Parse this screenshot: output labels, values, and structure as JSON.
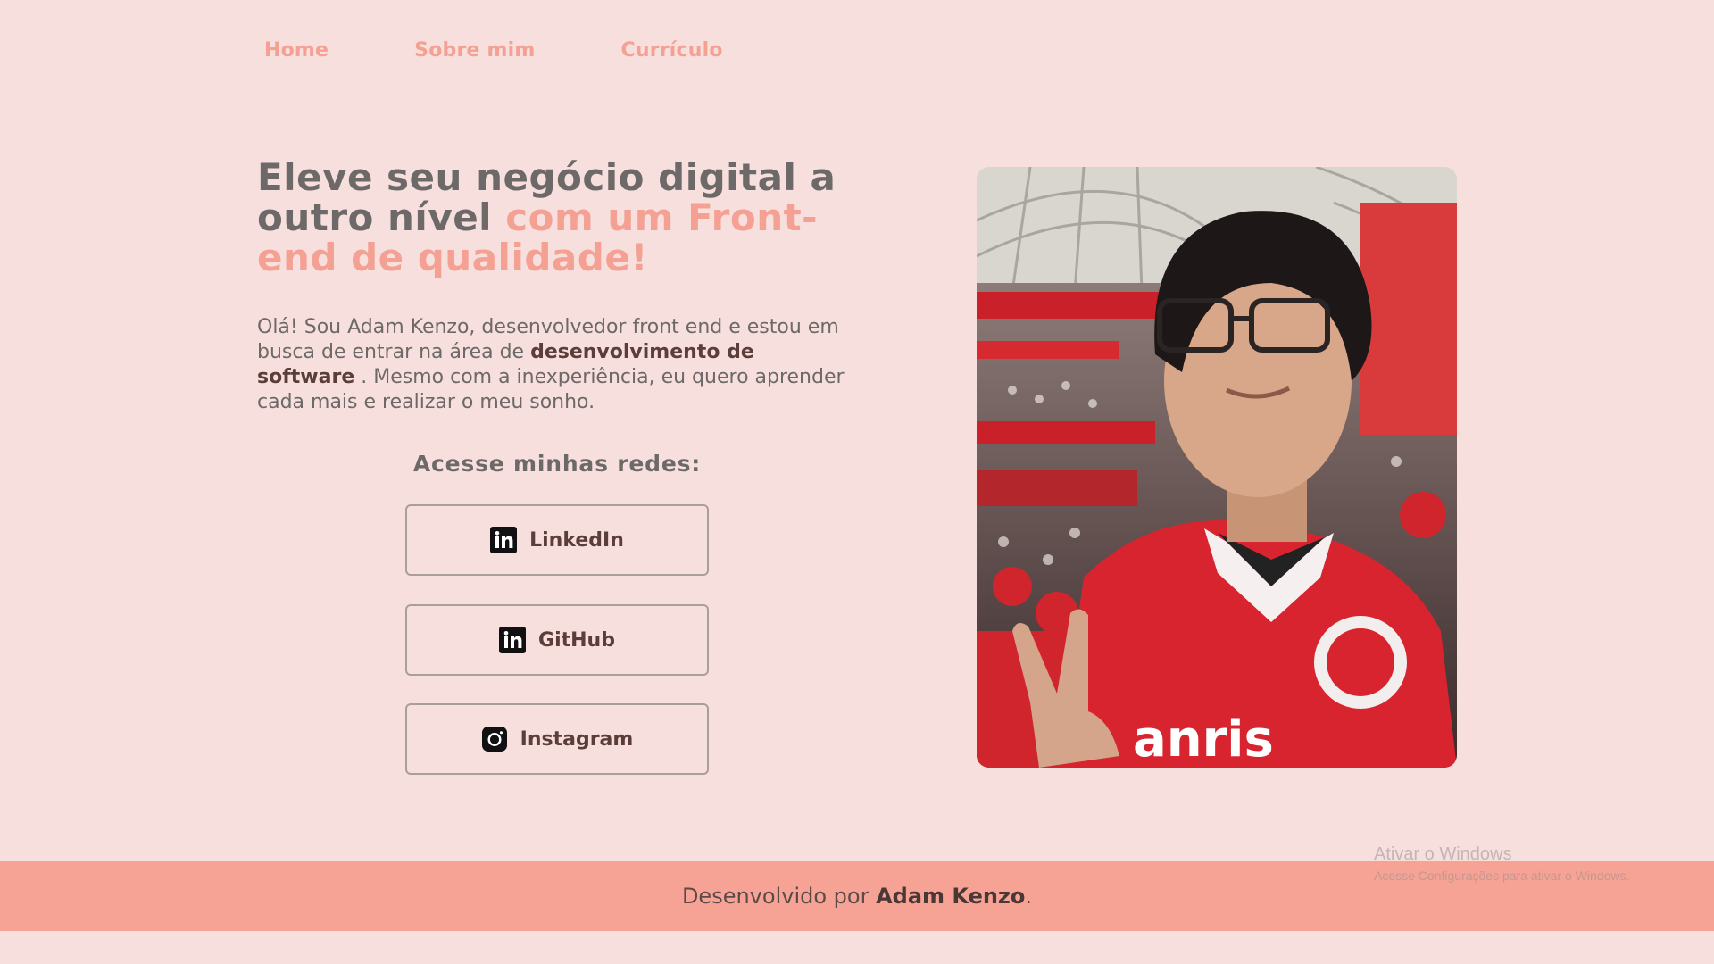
{
  "nav": {
    "items": [
      {
        "label": "Home"
      },
      {
        "label": "Sobre mim"
      },
      {
        "label": "Currículo"
      }
    ]
  },
  "hero": {
    "title_plain": "Eleve seu negócio digital a outro nível",
    "title_accent": "com um Front-end de qualidade!",
    "intro_pre": "Olá! Sou Adam Kenzo, desenvolvedor front end e estou em busca de entrar na área de",
    "intro_bold": "desenvolvimento de software",
    "intro_post": ". Mesmo com a inexperiência, eu quero aprender cada mais e realizar o meu sonho."
  },
  "socials": {
    "title": "Acesse minhas redes:",
    "buttons": [
      {
        "label": "LinkedIn",
        "icon": "linkedin-icon"
      },
      {
        "label": "GitHub",
        "icon": "linkedin-icon"
      },
      {
        "label": "Instagram",
        "icon": "instagram-icon"
      }
    ]
  },
  "footer": {
    "prefix": "Desenvolvido por",
    "name": "Adam Kenzo",
    "suffix": "."
  },
  "watermark": {
    "title": "Ativar o Windows",
    "subtitle": "Acesse Configurações para ativar o Windows."
  },
  "colors": {
    "background": "#f6dfdd",
    "accent": "#f4a093",
    "text": "#6d6968",
    "footer": "#f6a395"
  }
}
